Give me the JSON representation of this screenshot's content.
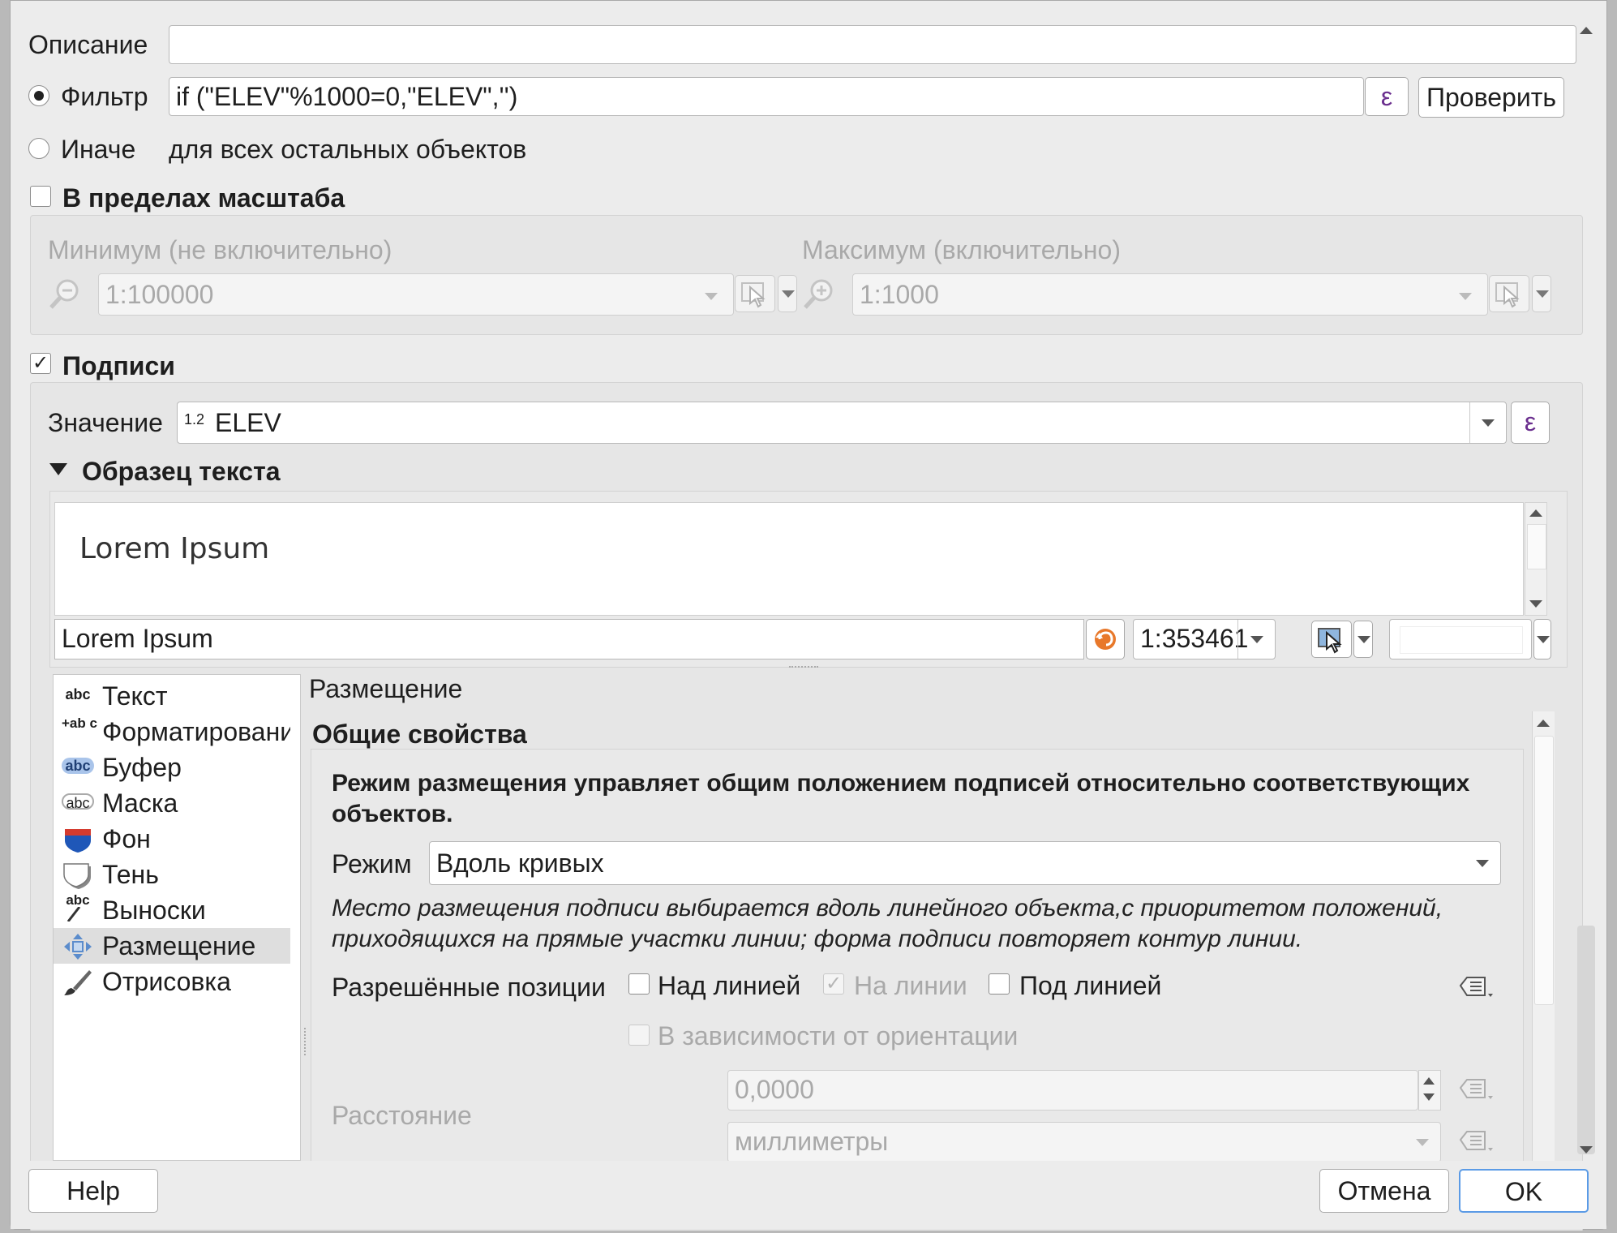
{
  "description": {
    "label": "Описание",
    "value": ""
  },
  "filter": {
    "label": "Фильтр",
    "value": "if (\"ELEV\"%1000=0,\"ELEV\",'')",
    "epsilon": "ε",
    "check_button": "Проверить"
  },
  "else": {
    "label": "Иначе",
    "text": "для всех остальных объектов"
  },
  "scale": {
    "label": "В пределах масштаба",
    "min_label": "Минимум (не включительно)",
    "min_value": "1:100000",
    "max_label": "Максимум (включительно)",
    "max_value": "1:1000"
  },
  "labels": {
    "label": "Подписи",
    "value_label": "Значение",
    "value_type_icon": "1.2",
    "value": "ELEV",
    "epsilon": "ε",
    "sample_header": "Образец текста",
    "preview_text": "Lorem Ipsum",
    "sample_input": "Lorem Ipsum",
    "scale_value": "1:353461"
  },
  "sidebar": {
    "items": [
      {
        "icon": "abc",
        "label": "Текст"
      },
      {
        "icon": "+ab c",
        "label": "Форматирование"
      },
      {
        "icon": "abc",
        "label": "Буфер"
      },
      {
        "icon": "abc",
        "label": "Маска"
      },
      {
        "icon": "",
        "label": "Фон"
      },
      {
        "icon": "",
        "label": "Тень"
      },
      {
        "icon": "abc",
        "label": "Выноски"
      },
      {
        "icon": "",
        "label": "Размещение"
      },
      {
        "icon": "",
        "label": "Отрисовка"
      }
    ]
  },
  "placement": {
    "title": "Размещение",
    "section": "Общие свойства",
    "description": "Режим размещения управляет общим положением подписей относительно соответствующих объектов.",
    "mode_label": "Режим",
    "mode_value": "Вдоль кривых",
    "mode_hint": "Место размещения подписи выбирается вдоль линейного объекта,с приоритетом положений, приходящихся на прямые участки линии; форма подписи повторяет контур линии.",
    "positions_label": "Разрешённые позиции",
    "above": "Над линией",
    "on": "На линии",
    "below": "Под линией",
    "orientation": "В зависимости от ориентации",
    "distance_label": "Расстояние",
    "distance_value": "0,0000",
    "unit_value": "миллиметры"
  },
  "footer": {
    "help": "Help",
    "cancel": "Отмена",
    "ok": "OK"
  }
}
